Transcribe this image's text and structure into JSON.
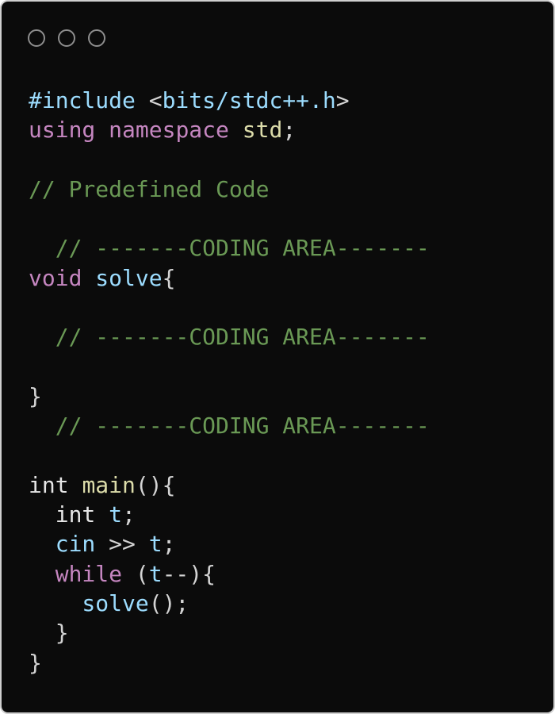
{
  "window": {
    "controls": [
      "circle-icon",
      "circle-icon",
      "circle-icon"
    ]
  },
  "code": {
    "lines": [
      [
        {
          "text": "#include ",
          "kind": "preproc"
        },
        {
          "text": "<",
          "kind": "angle"
        },
        {
          "text": "bits/stdc++.h",
          "kind": "header"
        },
        {
          "text": ">",
          "kind": "angle"
        }
      ],
      [
        {
          "text": "using ",
          "kind": "kw"
        },
        {
          "text": "namespace ",
          "kind": "kw"
        },
        {
          "text": "std",
          "kind": "ident"
        },
        {
          "text": ";",
          "kind": "punct"
        }
      ],
      [],
      [
        {
          "text": "// Predefined Code",
          "kind": "comment"
        }
      ],
      [],
      [
        {
          "text": "  // -------CODING AREA-------",
          "kind": "comment"
        }
      ],
      [
        {
          "text": "void ",
          "kind": "kw"
        },
        {
          "text": "solve",
          "kind": "fn"
        },
        {
          "text": "{",
          "kind": "punct"
        }
      ],
      [],
      [
        {
          "text": "  // -------CODING AREA-------",
          "kind": "comment"
        }
      ],
      [],
      [
        {
          "text": "}",
          "kind": "punct"
        }
      ],
      [
        {
          "text": "  // -------CODING AREA-------",
          "kind": "comment"
        }
      ],
      [],
      [
        {
          "text": "int ",
          "kind": "type"
        },
        {
          "text": "main",
          "kind": "ident"
        },
        {
          "text": "(){",
          "kind": "punct"
        }
      ],
      [
        {
          "text": "  int ",
          "kind": "type"
        },
        {
          "text": "t",
          "kind": "var"
        },
        {
          "text": ";",
          "kind": "punct"
        }
      ],
      [
        {
          "text": "  cin",
          "kind": "var"
        },
        {
          "text": " >> ",
          "kind": "op"
        },
        {
          "text": "t",
          "kind": "var"
        },
        {
          "text": ";",
          "kind": "punct"
        }
      ],
      [
        {
          "text": "  while ",
          "kind": "kw"
        },
        {
          "text": "(",
          "kind": "punct"
        },
        {
          "text": "t",
          "kind": "var"
        },
        {
          "text": "--){",
          "kind": "punct"
        }
      ],
      [
        {
          "text": "    solve",
          "kind": "fn"
        },
        {
          "text": "();",
          "kind": "punct"
        }
      ],
      [
        {
          "text": "  }",
          "kind": "punct"
        }
      ],
      [
        {
          "text": "}",
          "kind": "punct"
        }
      ]
    ]
  },
  "colors": {
    "background": "#0b0b0b",
    "keyword": "#c586c0",
    "comment": "#6a9955",
    "identifier": "#9cdcfe",
    "function_yellow": "#dcdcaa",
    "default_text": "#e6e6e6"
  }
}
